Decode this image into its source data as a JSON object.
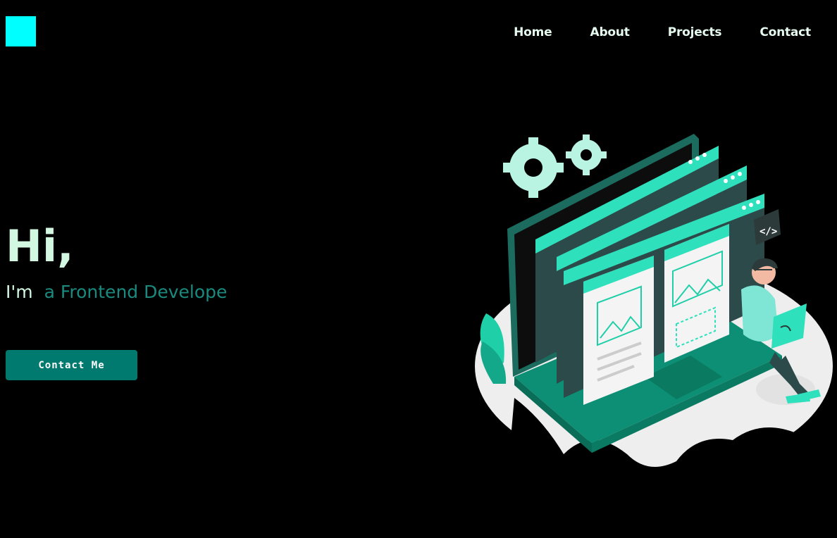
{
  "header": {
    "nav": [
      "Home",
      "About",
      "Projects",
      "Contact"
    ]
  },
  "hero": {
    "greeting": "Hi,",
    "prefix": "I'm",
    "role": "a Frontend Develope",
    "cta_label": "Contact Me"
  },
  "colors": {
    "background": "#000000",
    "logo": "#00ffff",
    "accent": "#00796f",
    "greeting_text": "#d3f8e2",
    "role_text": "#1a8a7f"
  },
  "illustration": {
    "icon": "developer-illustration",
    "code_tag": "</>"
  }
}
